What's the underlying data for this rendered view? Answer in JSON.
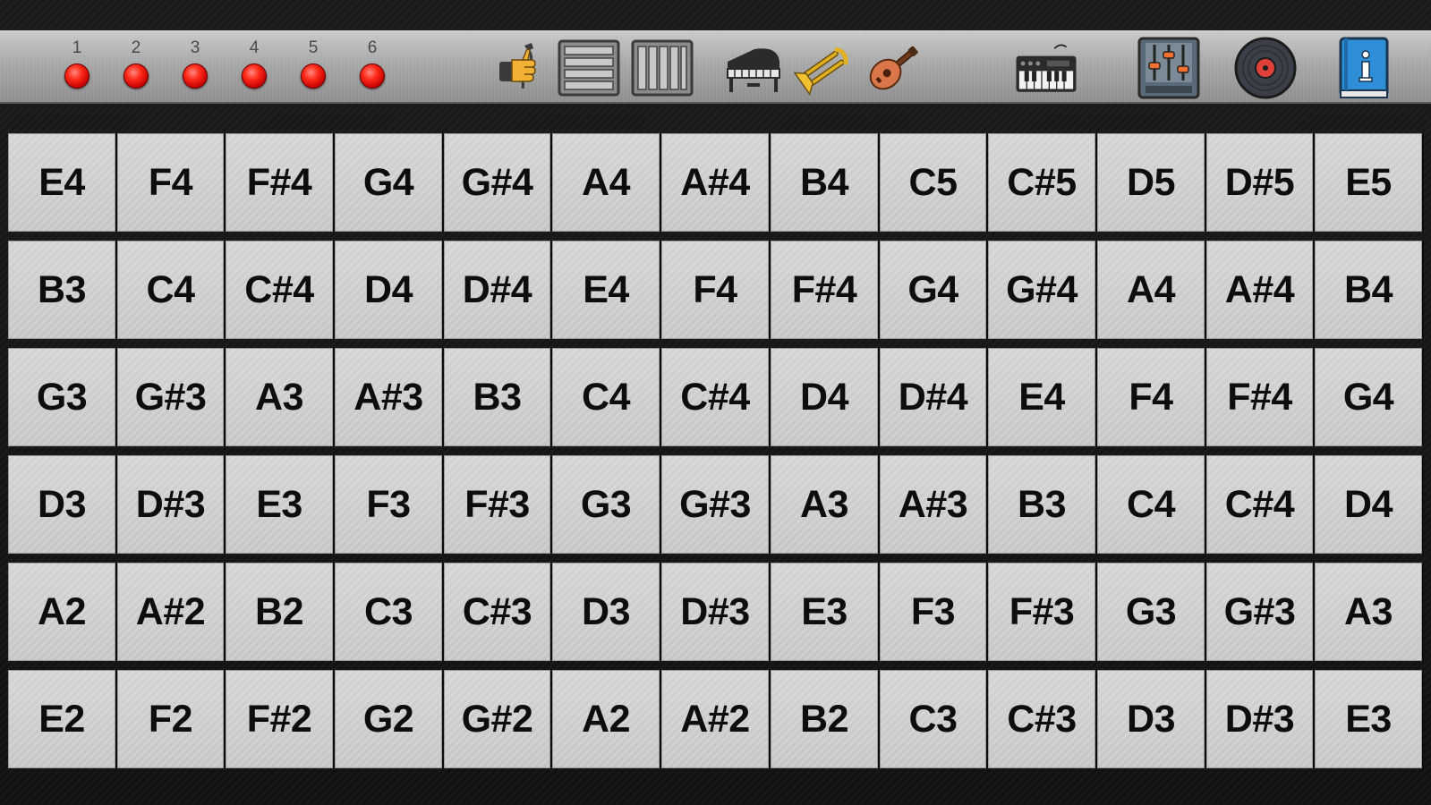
{
  "toolbar": {
    "string_indicators": [
      "1",
      "2",
      "3",
      "4",
      "5",
      "6"
    ],
    "led_color": "#ff1a0a",
    "icons": [
      {
        "name": "strum-hand-icon"
      },
      {
        "name": "rows-layout-icon"
      },
      {
        "name": "columns-layout-icon"
      },
      {
        "name": "piano-icon"
      },
      {
        "name": "trombone-icon"
      },
      {
        "name": "guitar-icon"
      },
      {
        "name": "synth-keyboard-icon"
      },
      {
        "name": "mixer-icon"
      },
      {
        "name": "record-disc-icon"
      },
      {
        "name": "info-book-icon"
      }
    ]
  },
  "fretboard": {
    "rows": [
      [
        "E4",
        "F4",
        "F#4",
        "G4",
        "G#4",
        "A4",
        "A#4",
        "B4",
        "C5",
        "C#5",
        "D5",
        "D#5",
        "E5"
      ],
      [
        "B3",
        "C4",
        "C#4",
        "D4",
        "D#4",
        "E4",
        "F4",
        "F#4",
        "G4",
        "G#4",
        "A4",
        "A#4",
        "B4"
      ],
      [
        "G3",
        "G#3",
        "A3",
        "A#3",
        "B3",
        "C4",
        "C#4",
        "D4",
        "D#4",
        "E4",
        "F4",
        "F#4",
        "G4"
      ],
      [
        "D3",
        "D#3",
        "E3",
        "F3",
        "F#3",
        "G3",
        "G#3",
        "A3",
        "A#3",
        "B3",
        "C4",
        "C#4",
        "D4"
      ],
      [
        "A2",
        "A#2",
        "B2",
        "C3",
        "C#3",
        "D3",
        "D#3",
        "E3",
        "F3",
        "F#3",
        "G3",
        "G#3",
        "A3"
      ],
      [
        "E2",
        "F2",
        "F#2",
        "G2",
        "G#2",
        "A2",
        "A#2",
        "B2",
        "C3",
        "C#3",
        "D3",
        "D#3",
        "E3"
      ]
    ]
  }
}
